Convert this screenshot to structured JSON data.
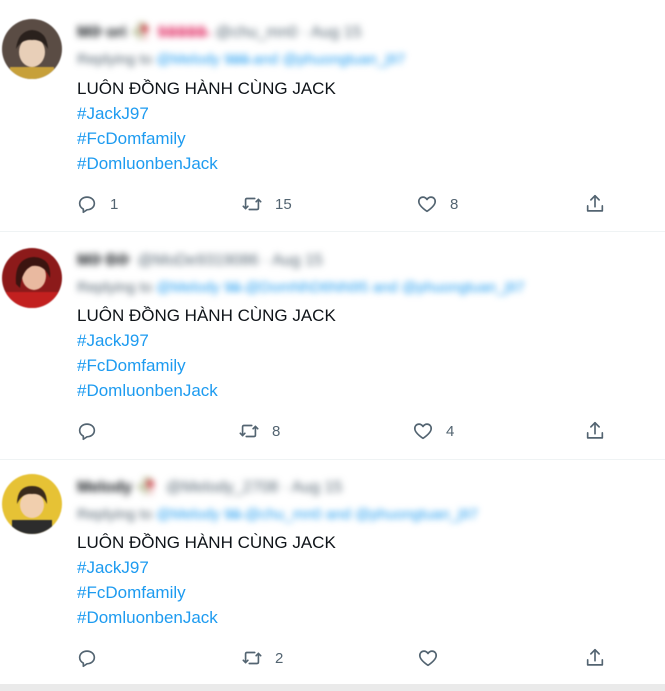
{
  "tweets": [
    {
      "display_name": "Mỡ ori",
      "name_emoji": "🥀 9̶9̶9̶9̶9̶",
      "handle_meta": "@chu_mn0 · Aug 15",
      "replying_label": "Replying to",
      "replying_to": "@Melody 9̶9̶9̶ and @phuongtuan_j97",
      "text": "LUÔN ĐỒNG HÀNH CÙNG JACK",
      "hashtags": [
        "#JackJ97",
        "#FcDomfamily",
        "#DomluonbenJack"
      ],
      "reply_count": "1",
      "retweet_count": "15",
      "like_count": "8",
      "avatar_colors": {
        "bg": "#5a4c44",
        "face": "#e8cfb8",
        "hair": "#2a211d"
      }
    },
    {
      "display_name": "Mỡ Đỡ",
      "name_emoji": "",
      "handle_meta": "@MoDe9319086 · Aug 15",
      "replying_label": "Replying to",
      "replying_to": "@Melody 9̶9̶ @DomNhD6NN95 and @phuongtuan_j97",
      "text": "LUÔN ĐỒNG HÀNH CÙNG JACK",
      "hashtags": [
        "#JackJ97",
        "#FcDomfamily",
        "#DomluonbenJack"
      ],
      "reply_count": "",
      "retweet_count": "8",
      "like_count": "4",
      "avatar_colors": {
        "bg": "#8c1a1a",
        "face": "#e9b9a0",
        "hair": "#3b1410"
      }
    },
    {
      "display_name": "Melody",
      "name_emoji": "🥀",
      "handle_meta": "@Melody_2708 · Aug 15",
      "replying_label": "Replying to",
      "replying_to": "@Melody 9̶9̶ @chu_mn0 and @phuongtuan_j97",
      "text": "LUÔN ĐỒNG HÀNH CÙNG JACK",
      "hashtags": [
        "#JackJ97",
        "#FcDomfamily",
        "#DomluonbenJack"
      ],
      "reply_count": "",
      "retweet_count": "2",
      "like_count": "",
      "avatar_colors": {
        "bg": "#e6c235",
        "face": "#f1cfae",
        "hair": "#3a2a1c"
      }
    }
  ],
  "icons": {
    "reply": "reply-icon",
    "retweet": "retweet-icon",
    "like": "heart-icon",
    "share": "share-icon"
  },
  "colors": {
    "hashtag": "#1d9bf0",
    "text": "#0f1419",
    "icon": "#536471",
    "divider": "#eff3f4"
  }
}
